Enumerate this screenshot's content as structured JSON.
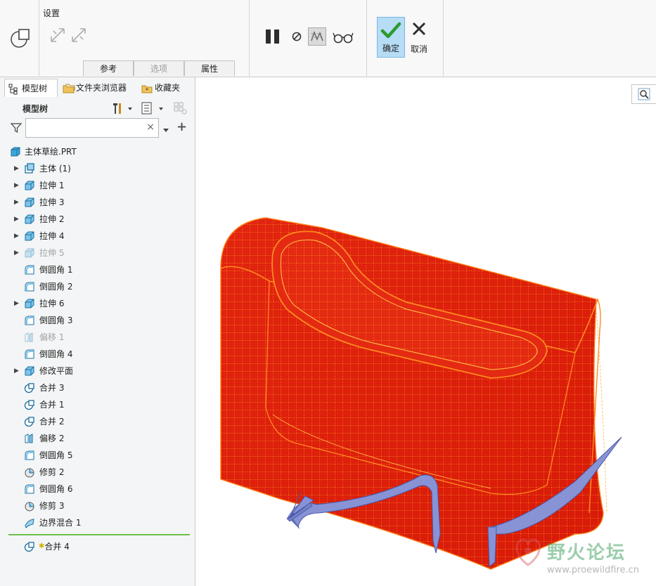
{
  "ribbon": {
    "settings_label": "设置",
    "subtabs": [
      {
        "label": "参考",
        "enabled": true
      },
      {
        "label": "选项",
        "enabled": false
      },
      {
        "label": "属性",
        "enabled": true
      }
    ],
    "ok_label": "确定",
    "cancel_label": "取消"
  },
  "panel": {
    "tabs": [
      {
        "label": "模型树",
        "icon": "model-tree-icon"
      },
      {
        "label": "文件夹浏览器",
        "icon": "folder-browser-icon"
      },
      {
        "label": "收藏夹",
        "icon": "favorites-icon"
      }
    ],
    "header": "模型树",
    "filter": {
      "value": "",
      "clear": "×",
      "add": "+"
    }
  },
  "tree": {
    "root": "主体草绘.PRT",
    "items": [
      {
        "label": "主体 (1)",
        "icon": "body-icon",
        "expandable": true,
        "suppressed": false
      },
      {
        "label": "拉伸 1",
        "icon": "extrude-icon",
        "expandable": true,
        "suppressed": false
      },
      {
        "label": "拉伸 3",
        "icon": "extrude-icon",
        "expandable": true,
        "suppressed": false
      },
      {
        "label": "拉伸 2",
        "icon": "extrude-icon",
        "expandable": true,
        "suppressed": false
      },
      {
        "label": "拉伸 4",
        "icon": "extrude-icon",
        "expandable": true,
        "suppressed": false
      },
      {
        "label": "拉伸 5",
        "icon": "extrude-icon",
        "expandable": true,
        "suppressed": true
      },
      {
        "label": "倒圆角 1",
        "icon": "round-icon",
        "expandable": false,
        "suppressed": false
      },
      {
        "label": "倒圆角 2",
        "icon": "round-icon",
        "expandable": false,
        "suppressed": false
      },
      {
        "label": "拉伸 6",
        "icon": "extrude-icon",
        "expandable": true,
        "suppressed": false
      },
      {
        "label": "倒圆角 3",
        "icon": "round-icon",
        "expandable": false,
        "suppressed": false
      },
      {
        "label": "偏移 1",
        "icon": "offset-icon",
        "expandable": false,
        "suppressed": true
      },
      {
        "label": "倒圆角 4",
        "icon": "round-icon",
        "expandable": false,
        "suppressed": false
      },
      {
        "label": "修改平面",
        "icon": "extrude-icon",
        "expandable": true,
        "suppressed": false
      },
      {
        "label": "合并 3",
        "icon": "merge-icon",
        "expandable": false,
        "suppressed": false
      },
      {
        "label": "合并 1",
        "icon": "merge-icon",
        "expandable": false,
        "suppressed": false
      },
      {
        "label": "合并 2",
        "icon": "merge-icon",
        "expandable": false,
        "suppressed": false
      },
      {
        "label": "偏移 2",
        "icon": "offset-icon",
        "expandable": false,
        "suppressed": false
      },
      {
        "label": "倒圆角 5",
        "icon": "round-icon",
        "expandable": false,
        "suppressed": false
      },
      {
        "label": "修剪 2",
        "icon": "trim-icon",
        "expandable": false,
        "suppressed": false
      },
      {
        "label": "倒圆角 6",
        "icon": "round-icon",
        "expandable": false,
        "suppressed": false
      },
      {
        "label": "修剪 3",
        "icon": "trim-icon",
        "expandable": false,
        "suppressed": false
      },
      {
        "label": "边界混合 1",
        "icon": "boundary-blend-icon",
        "expandable": false,
        "suppressed": false
      }
    ],
    "active_item": {
      "label": "合并 4",
      "icon": "merge-icon"
    }
  },
  "watermark": {
    "title": "野火论坛",
    "url": "www.proewildfire.cn"
  },
  "colors": {
    "accent": "#1e78c8",
    "ok_bg": "#b6dcf6",
    "model_red": "#e8230e",
    "mesh": "#ffb020",
    "surface": "#8893d6",
    "insert_line": "#6cc04a"
  }
}
